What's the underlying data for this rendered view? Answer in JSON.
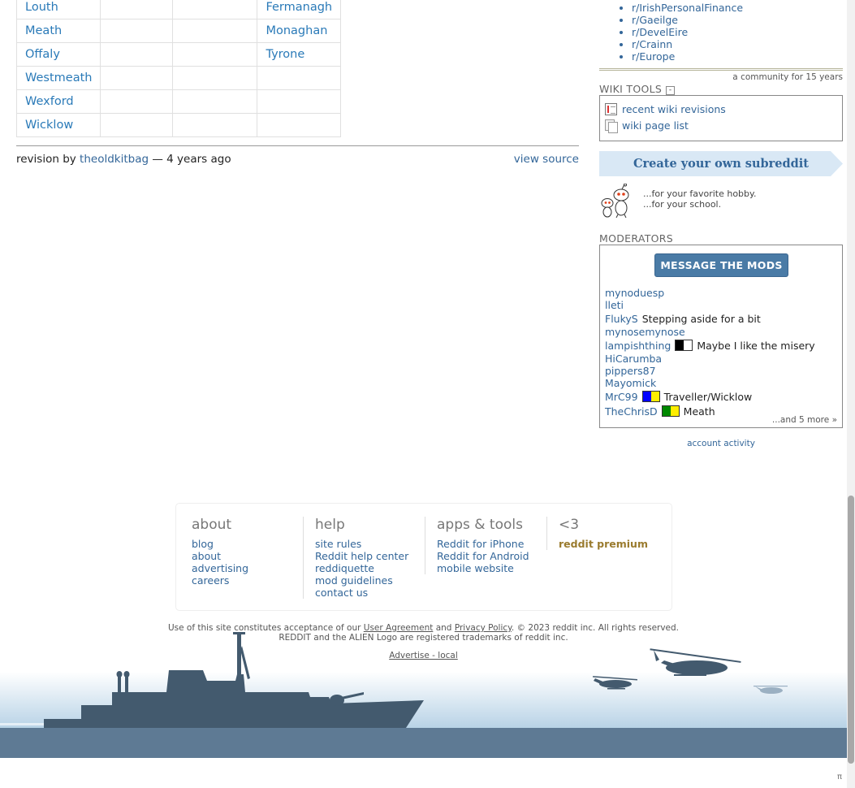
{
  "counties": {
    "rows": [
      [
        "Louth",
        "",
        "",
        "Fermanagh"
      ],
      [
        "Meath",
        "",
        "",
        "Monaghan"
      ],
      [
        "Offaly",
        "",
        "",
        "Tyrone"
      ],
      [
        "Westmeath",
        "",
        "",
        ""
      ],
      [
        "Wexford",
        "",
        "",
        ""
      ],
      [
        "Wicklow",
        "",
        "",
        ""
      ]
    ]
  },
  "revision": {
    "prefix": "revision by",
    "user": "theoldkitbag",
    "suffix": "— 4 years ago",
    "view_source": "view source"
  },
  "sidebar": {
    "related": [
      "r/IrishPersonalFinance",
      "r/Gaeilge",
      "r/DevelEire",
      "r/Crainn",
      "r/Europe"
    ],
    "community_age": "a community for 15 years",
    "wiki_tools_title": "WIKI TOOLS",
    "wiki_tools_collapse": "-",
    "wiki_tools": [
      "recent wiki revisions",
      "wiki page list"
    ],
    "create_subreddit": "Create your own subreddit",
    "hobby_lines": [
      "...for your favorite hobby.",
      "...for your school."
    ],
    "moderators_title": "MODERATORS",
    "message_mods": "MESSAGE THE MODS",
    "mods": [
      {
        "name": "mynoduesp",
        "flair": "",
        "colors": []
      },
      {
        "name": "lleti",
        "flair": "",
        "colors": []
      },
      {
        "name": "FlukyS",
        "flair": "Stepping aside for a bit",
        "colors": []
      },
      {
        "name": "mynosemynose",
        "flair": "",
        "colors": []
      },
      {
        "name": "lampishthing",
        "flair": "Maybe I like the misery",
        "colors": [
          "#000000",
          "#ffffff"
        ]
      },
      {
        "name": "HiCarumba",
        "flair": "",
        "colors": []
      },
      {
        "name": "pippers87",
        "flair": "",
        "colors": []
      },
      {
        "name": "Mayomick",
        "flair": "",
        "colors": []
      },
      {
        "name": "MrC99",
        "flair": "Traveller/Wicklow",
        "colors": [
          "#0000ff",
          "#ffee00"
        ]
      },
      {
        "name": "TheChrisD",
        "flair": "Meath",
        "colors": [
          "#008800",
          "#ffee00"
        ]
      }
    ],
    "more_mods": "...and 5 more »",
    "account_activity": "account activity"
  },
  "footer": {
    "columns": [
      {
        "title": "about",
        "links": [
          "blog",
          "about",
          "advertising",
          "careers"
        ]
      },
      {
        "title": "help",
        "links": [
          "site rules",
          "Reddit help center",
          "reddiquette",
          "mod guidelines",
          "contact us"
        ]
      },
      {
        "title": "apps & tools",
        "links": [
          "Reddit for iPhone",
          "Reddit for Android",
          "mobile website"
        ]
      },
      {
        "title": "<3",
        "links": [
          "reddit premium"
        ]
      }
    ],
    "legal_pre": "Use of this site constitutes acceptance of our",
    "user_agreement": "User Agreement",
    "and": "and",
    "privacy_policy": "Privacy Policy",
    "legal_post": ". © 2023 reddit inc. All rights reserved.",
    "trademark": "REDDIT and the ALIEN Logo are registered trademarks of reddit inc.",
    "advertise": "Advertise - local",
    "pi": "π"
  },
  "colors": {
    "link": "#336699",
    "wiki_link": "#2a7ab8",
    "sea": "#5e7a94",
    "silhouette": "#435a6e",
    "sky": "#b7d2e6",
    "premium": "#9a7b2e",
    "button": "#4a7ba6"
  }
}
